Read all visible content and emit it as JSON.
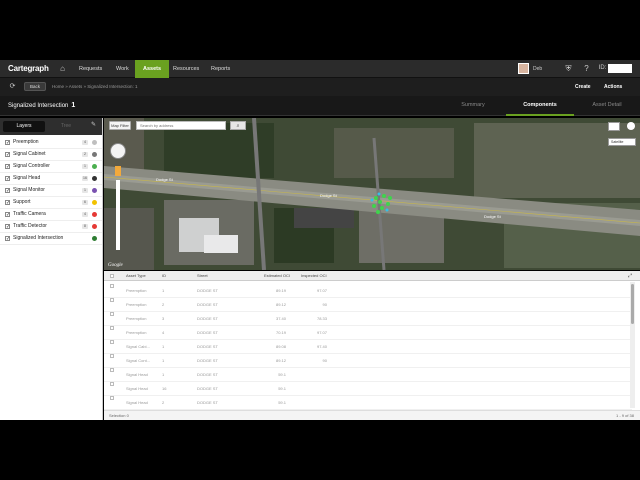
{
  "nav": {
    "brand": "Cartegraph",
    "links": [
      "Requests",
      "Work",
      "Assets",
      "Resources",
      "Reports"
    ],
    "active": "Assets",
    "user": "Deb",
    "id_label": "ID:"
  },
  "subnav": {
    "back": "Back",
    "breadcrumb": "Home  »  Assets  »  Signalized Intersection: 1",
    "create": "Create",
    "actions": "Actions"
  },
  "header": {
    "title": "Signalized Intersection",
    "id": "1",
    "tabs": [
      "Summary",
      "Components",
      "Asset Detail"
    ],
    "active_tab": "Components"
  },
  "sidebar": {
    "tabs": [
      "Layers",
      "Tree"
    ],
    "layers": [
      {
        "name": "Preemption",
        "count": "4",
        "color": "#bfbfbf"
      },
      {
        "name": "Signal Cabinet",
        "count": "2",
        "color": "#777777"
      },
      {
        "name": "Signal Controller",
        "count": "1",
        "color": "#4caf50"
      },
      {
        "name": "Signal Head",
        "count": "16",
        "color": "#333333"
      },
      {
        "name": "Signal Monitor",
        "count": "1",
        "color": "#7a52b0"
      },
      {
        "name": "Support",
        "count": "6",
        "color": "#f2c200"
      },
      {
        "name": "Traffic Camera",
        "count": "4",
        "color": "#e53935"
      },
      {
        "name": "Traffic Detector",
        "count": "8",
        "color": "#e53935"
      },
      {
        "name": "Signalized Intersection",
        "count": "",
        "color": "#2e7d32"
      }
    ]
  },
  "map": {
    "map_filter": "Map Filter",
    "search_placeholder": "Search by address",
    "layer_select": "Satellite",
    "road_labels": [
      "Dodge St",
      "Dodge St",
      "Dodge St"
    ],
    "watermark": "Google"
  },
  "table": {
    "columns": [
      "Asset Type",
      "ID",
      "Street",
      "Estimated OCI",
      "Inspected OCI"
    ],
    "rows": [
      [
        "Preemption",
        "1",
        "DODGE ST",
        "89.19",
        "97.07"
      ],
      [
        "Preemption",
        "2",
        "DODGE ST",
        "89.12",
        "90"
      ],
      [
        "Preemption",
        "3",
        "DODGE ST",
        "37.40",
        "78.33"
      ],
      [
        "Preemption",
        "4",
        "DODGE ST",
        "70.19",
        "97.07"
      ],
      [
        "Signal Cabi...",
        "1",
        "DODGE ST",
        "89.08",
        "97.40"
      ],
      [
        "Signal Cont...",
        "1",
        "DODGE ST",
        "89.12",
        "90"
      ],
      [
        "Signal Head",
        "1",
        "DODGE ST",
        "59.1",
        ""
      ],
      [
        "Signal Head",
        "16",
        "DODGE ST",
        "59.1",
        ""
      ],
      [
        "Signal Head",
        "2",
        "DODGE ST",
        "59.1",
        ""
      ]
    ],
    "selection": "Selection 0",
    "pager": "1 - 9 of 38"
  }
}
